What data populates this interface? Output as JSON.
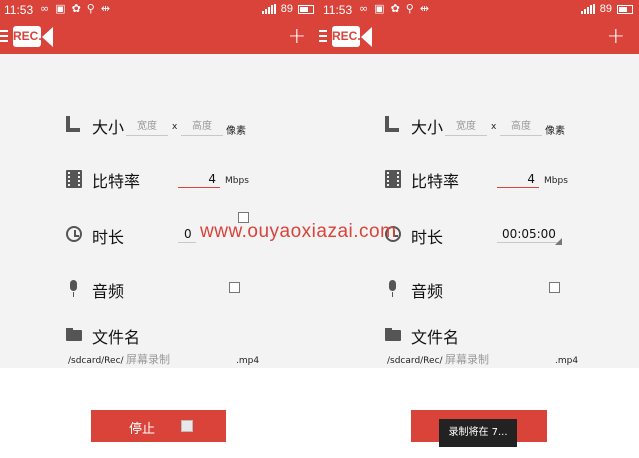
{
  "colors": {
    "accent": "#d9433a",
    "content_bg": "#f3f3f3",
    "watermark": "#d9433a"
  },
  "watermark": "www.ouyaoxiazai.com",
  "panels": [
    {
      "status": {
        "time": "11:53",
        "battery": "89"
      },
      "app": {
        "logo": "REC.",
        "add_icon": "plus-icon"
      },
      "size": {
        "label": "大小",
        "width_placeholder": "宽度",
        "x": "x",
        "height_placeholder": "高度",
        "unit": "像素"
      },
      "bitrate": {
        "label": "比特率",
        "value": "4",
        "unit": "Mbps"
      },
      "duration": {
        "label": "时长",
        "value": "0"
      },
      "audio": {
        "label": "音频"
      },
      "filename": {
        "label": "文件名",
        "path": "/sdcard/Rec/",
        "placeholder": "屏幕录制",
        "ext": ".mp4"
      },
      "button": {
        "label": "停止"
      }
    },
    {
      "status": {
        "time": "11:53",
        "battery": "89"
      },
      "app": {
        "logo": "REC.",
        "add_icon": "plus-icon"
      },
      "size": {
        "label": "大小",
        "width_placeholder": "宽度",
        "x": "x",
        "height_placeholder": "高度",
        "unit": "像素"
      },
      "bitrate": {
        "label": "比特率",
        "value": "4",
        "unit": "Mbps"
      },
      "duration": {
        "label": "时长",
        "value": "00:05:00"
      },
      "audio": {
        "label": "音频"
      },
      "filename": {
        "label": "文件名",
        "path": "/sdcard/Rec/",
        "placeholder": "屏幕录制",
        "ext": ".mp4"
      },
      "toast": "录制将在 7..."
    }
  ]
}
